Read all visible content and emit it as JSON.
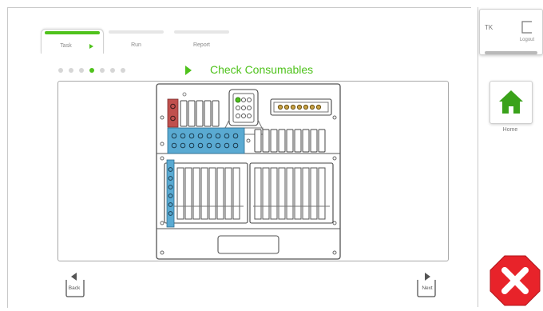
{
  "tabs": [
    {
      "label": "Task",
      "active": true
    },
    {
      "label": "Run",
      "active": false
    },
    {
      "label": "Report",
      "active": false
    }
  ],
  "step": {
    "total": 7,
    "current": 4,
    "title": "Check Consumables"
  },
  "user": {
    "initials": "TK",
    "logout_label": "Logout"
  },
  "home_label": "Home",
  "nav": {
    "back_label": "Back",
    "next_label": "Next"
  },
  "colors": {
    "accent": "#4fc21c",
    "highlight_blue": "#5aaad2",
    "highlight_red": "#c0504d",
    "close_red": "#e8232a"
  }
}
